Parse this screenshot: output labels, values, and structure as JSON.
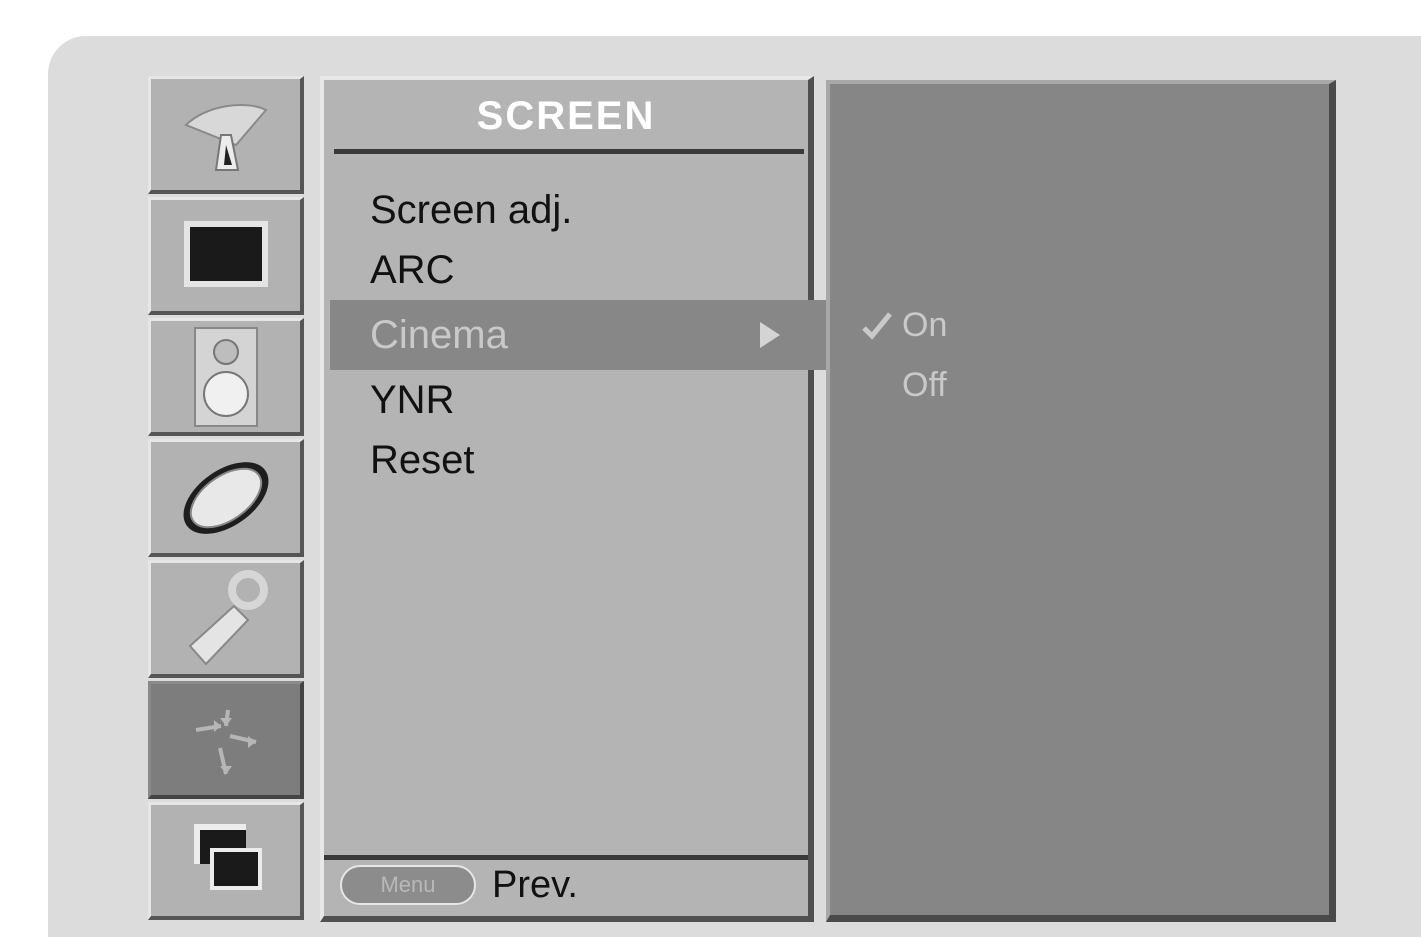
{
  "sidebar": {
    "items": [
      {
        "icon": "satellite-dish-icon"
      },
      {
        "icon": "tv-picture-icon"
      },
      {
        "icon": "speaker-icon"
      },
      {
        "icon": "clock-icon"
      },
      {
        "icon": "wrench-icon"
      },
      {
        "icon": "screen-adjust-icon",
        "active": true
      },
      {
        "icon": "pip-icon"
      }
    ]
  },
  "menu": {
    "title": "SCREEN",
    "items": [
      {
        "label": "Screen adj."
      },
      {
        "label": "ARC"
      },
      {
        "label": "Cinema",
        "selected": true
      },
      {
        "label": "YNR"
      },
      {
        "label": "Reset"
      }
    ],
    "footer": {
      "button_label": "Menu",
      "action_label": "Prev."
    }
  },
  "submenu": {
    "options": [
      {
        "label": "On",
        "checked": true
      },
      {
        "label": "Off",
        "checked": false
      }
    ]
  },
  "colors": {
    "panel": "#b4b4b4",
    "selection": "#878787",
    "submenu": "#868686",
    "title": "#ffffff"
  }
}
